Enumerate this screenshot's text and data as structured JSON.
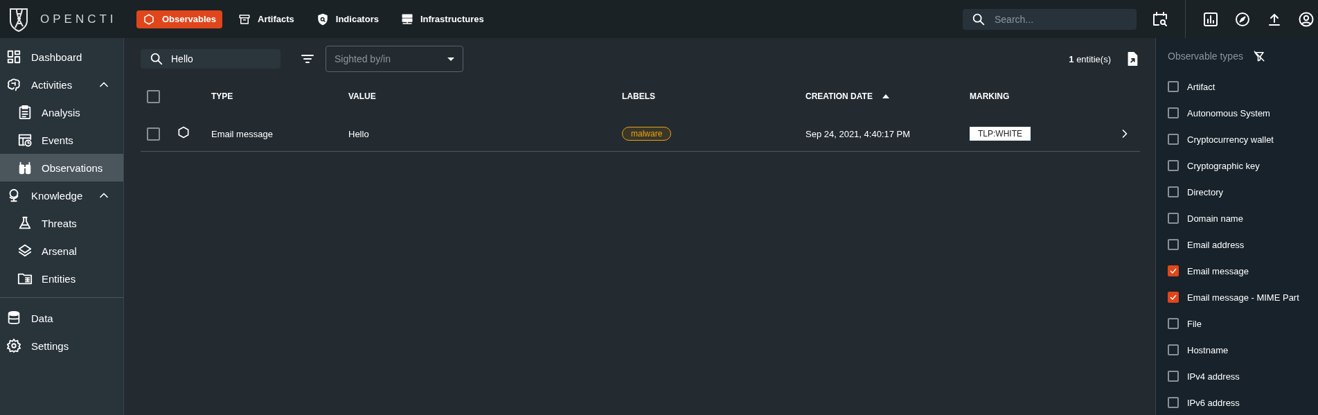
{
  "app": {
    "logo_text": "OPENCTI"
  },
  "top_nav": [
    {
      "label": "Observables",
      "selected": true
    },
    {
      "label": "Artifacts",
      "selected": false
    },
    {
      "label": "Indicators",
      "selected": false
    },
    {
      "label": "Infrastructures",
      "selected": false
    }
  ],
  "global_search": {
    "placeholder": "Search..."
  },
  "sidebar": {
    "items": [
      {
        "label": "Dashboard",
        "selected": false
      },
      {
        "label": "Activities",
        "selected": false,
        "expanded": true,
        "children": [
          {
            "label": "Analysis",
            "selected": false
          },
          {
            "label": "Events",
            "selected": false
          },
          {
            "label": "Observations",
            "selected": true
          }
        ]
      },
      {
        "label": "Knowledge",
        "selected": false,
        "expanded": true,
        "children": [
          {
            "label": "Threats",
            "selected": false
          },
          {
            "label": "Arsenal",
            "selected": false
          },
          {
            "label": "Entities",
            "selected": false
          }
        ]
      }
    ],
    "bottom_items": [
      {
        "label": "Data",
        "selected": false
      },
      {
        "label": "Settings",
        "selected": false
      }
    ]
  },
  "toolbar": {
    "search_value": "Hello",
    "filter_placeholder": "Sighted by/in",
    "count": "**1** entitie(s)"
  },
  "table": {
    "select_all_checked": false,
    "columns": [
      {
        "label": "TYPE",
        "sorted": false
      },
      {
        "label": "VALUE",
        "sorted": false
      },
      {
        "label": "LABELS",
        "sorted": false
      },
      {
        "label": "CREATION DATE",
        "sorted": true
      },
      {
        "label": "MARKING",
        "sorted": false
      }
    ],
    "rows": [
      {
        "checked": false,
        "type": "Email message",
        "value": "Hello",
        "labels": [
          "malware"
        ],
        "creation_date": "Sep 24, 2021, 4:40:17 PM",
        "marking": "TLP:WHITE"
      }
    ]
  },
  "filter_panel": {
    "title": "Observable types",
    "items": [
      {
        "label": "Artifact",
        "checked": false
      },
      {
        "label": "Autonomous System",
        "checked": false
      },
      {
        "label": "Cryptocurrency wallet",
        "checked": false
      },
      {
        "label": "Cryptographic key",
        "checked": false
      },
      {
        "label": "Directory",
        "checked": false
      },
      {
        "label": "Domain name",
        "checked": false
      },
      {
        "label": "Email address",
        "checked": false
      },
      {
        "label": "Email message",
        "checked": true
      },
      {
        "label": "Email message - MIME Part",
        "checked": true
      },
      {
        "label": "File",
        "checked": false
      },
      {
        "label": "Hostname",
        "checked": false
      },
      {
        "label": "IPv4 address",
        "checked": false
      },
      {
        "label": "IPv6 address",
        "checked": false
      }
    ]
  }
}
